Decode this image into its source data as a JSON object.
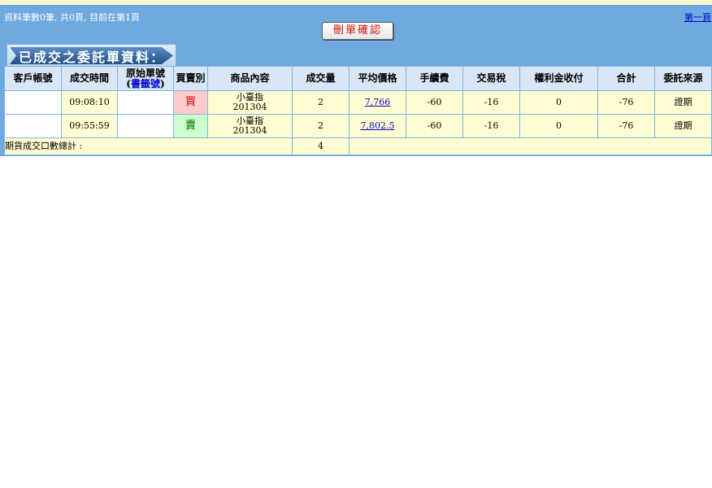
{
  "header": {
    "info_text": "資料筆數0筆, 共0頁, 目前在第1頁",
    "first_page_link": "第一頁",
    "delete_confirm_button": "刪單確認"
  },
  "section_title": "已成交之委託單資料：",
  "table": {
    "columns": {
      "account": "客戶帳號",
      "trade_time": "成交時間",
      "order_no_line1": "原始單號",
      "order_no_link": "書籤號",
      "side": "買賣別",
      "product": "商品內容",
      "qty": "成交量",
      "avg_price": "平均價格",
      "fee": "手續費",
      "tax": "交易稅",
      "premium": "權利金收付",
      "total": "合計",
      "source": "委託來源"
    },
    "rows": [
      {
        "account": "",
        "trade_time": "09:08:10",
        "order_no": "",
        "side": "買",
        "product_name": "小臺指",
        "product_month": "201304",
        "qty": "2",
        "avg_price": "7,766",
        "fee": "-60",
        "tax": "-16",
        "premium": "0",
        "total": "-76",
        "source": "證期"
      },
      {
        "account": "",
        "trade_time": "09:55:59",
        "order_no": "",
        "side": "賣",
        "product_name": "小臺指",
        "product_month": "201304",
        "qty": "2",
        "avg_price": "7,802.5",
        "fee": "-60",
        "tax": "-16",
        "premium": "0",
        "total": "-76",
        "source": "證期"
      }
    ],
    "summary": {
      "label": "期貨成交口數總計 :",
      "value": "4"
    }
  }
}
